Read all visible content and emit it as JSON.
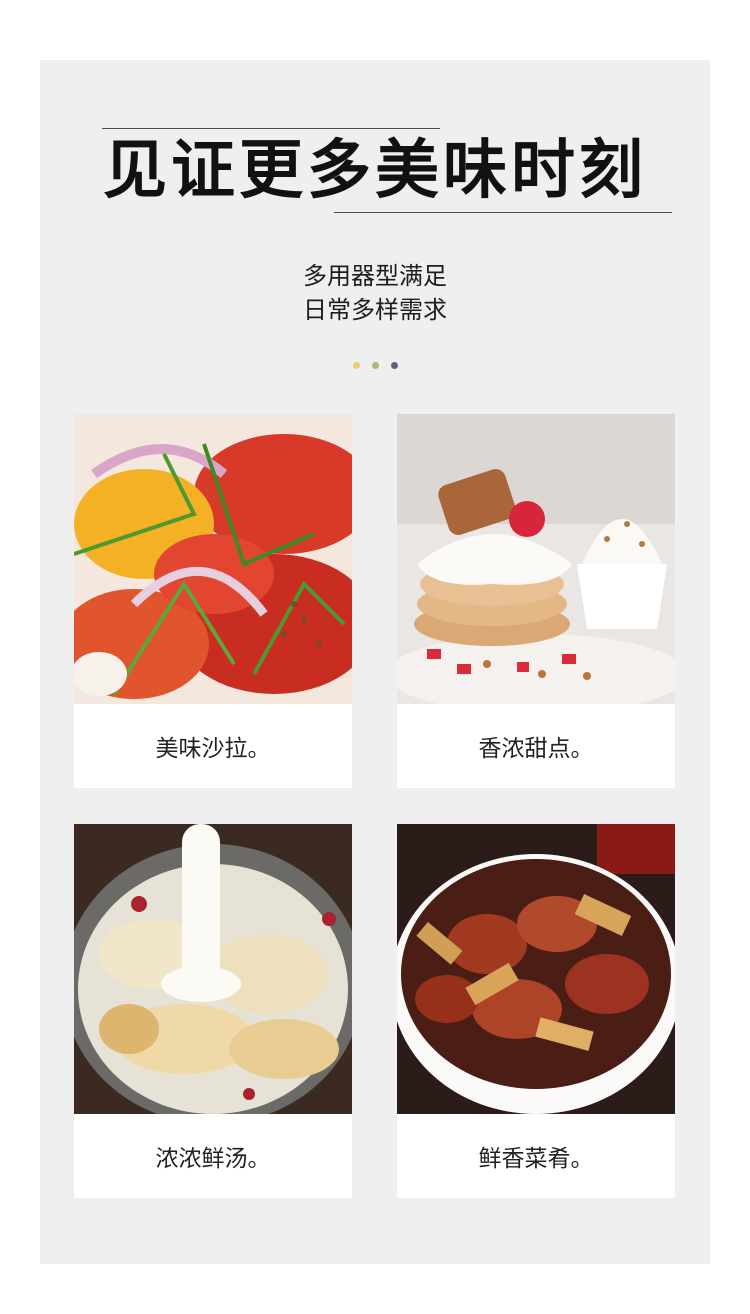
{
  "page": {
    "title": "见证更多美味时刻",
    "subtitle_line1": "多用器型满足",
    "subtitle_line2": "日常多样需求"
  },
  "dots": [
    "#f1cf6d",
    "#a9b97c",
    "#6a5b86"
  ],
  "cards": [
    {
      "caption": "美味沙拉。",
      "image": "salad-photo"
    },
    {
      "caption": "香浓甜点。",
      "image": "dessert-photo"
    },
    {
      "caption": "浓浓鲜汤。",
      "image": "soup-photo"
    },
    {
      "caption": "鲜香菜肴。",
      "image": "braised-dish-photo"
    }
  ]
}
